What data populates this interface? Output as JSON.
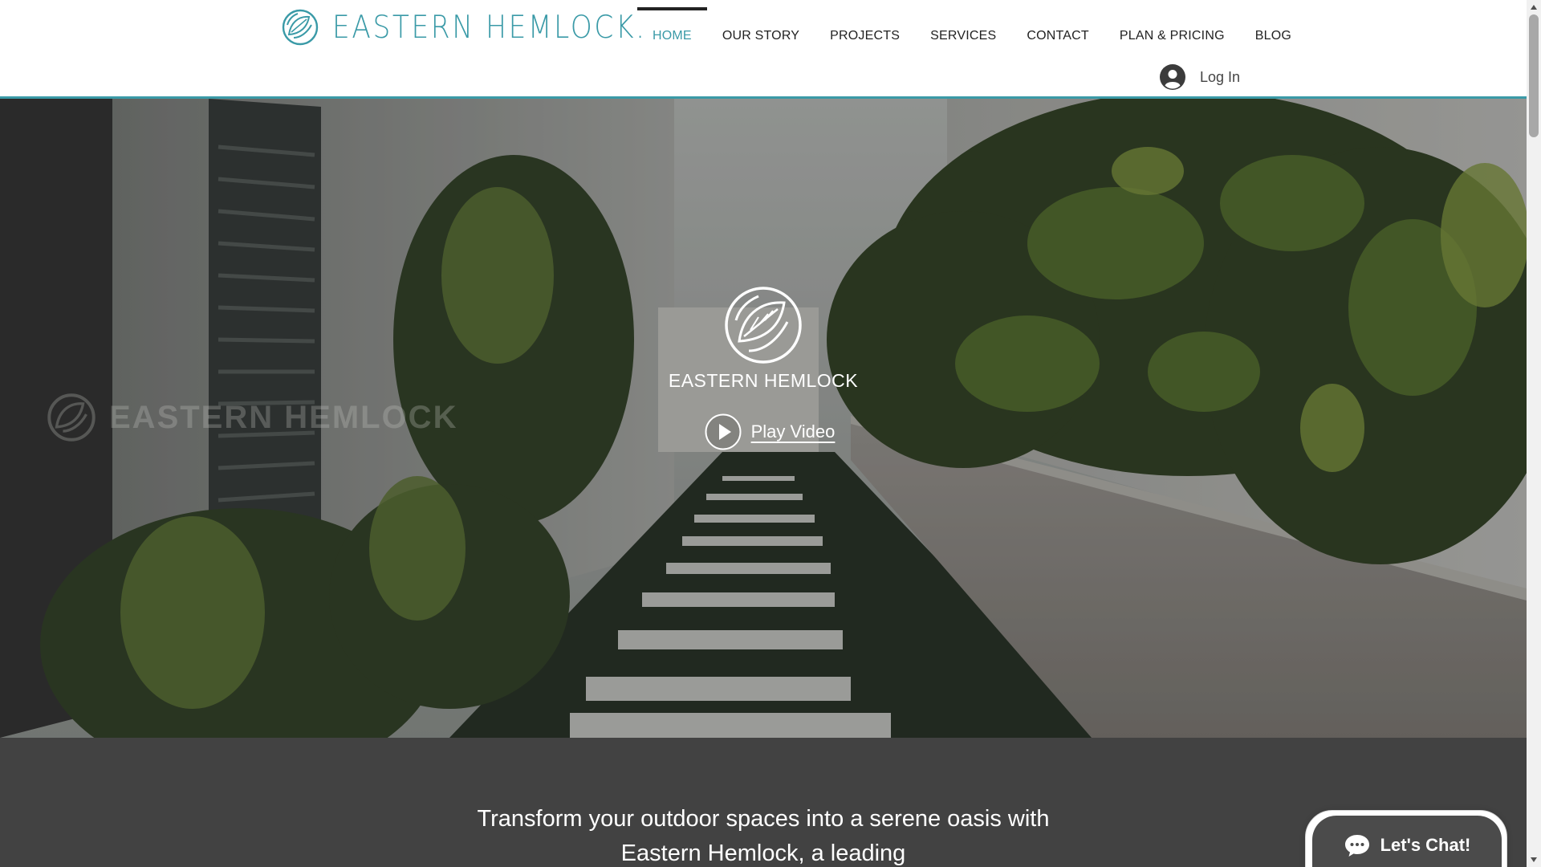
{
  "header": {
    "brand": "EASTERN HEMLOCK.",
    "nav": [
      {
        "label": "HOME",
        "active": true
      },
      {
        "label": "OUR STORY",
        "active": false
      },
      {
        "label": "PROJECTS",
        "active": false
      },
      {
        "label": "SERVICES",
        "active": false
      },
      {
        "label": "CONTACT",
        "active": false
      },
      {
        "label": "PLAN & PRICING",
        "active": false
      },
      {
        "label": "BLOG",
        "active": false
      }
    ],
    "login_label": "Log In"
  },
  "hero": {
    "watermark_text": "EASTERN HEMLOCK",
    "brand": "EASTERN HEMLOCK",
    "play_label": "Play Video"
  },
  "intro": {
    "text": "Transform your outdoor spaces into a serene oasis with Eastern Hemlock, a leading"
  },
  "chat": {
    "label": "Let's Chat!"
  },
  "colors": {
    "accent": "#3a9aa7",
    "nav_text": "#222222",
    "section_bg": "#424242",
    "chat_bg": "#4b4b4b"
  },
  "icons": {
    "logo": "leaf-circle-logo-icon",
    "login": "user-avatar-icon",
    "play": "play-circle-icon",
    "chat": "chat-bubble-icon"
  }
}
